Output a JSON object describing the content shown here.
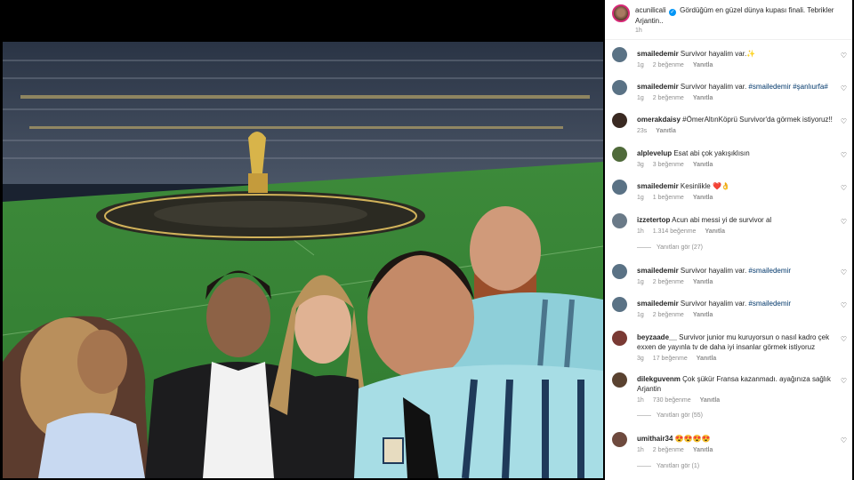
{
  "caption": {
    "username": "acunilicali",
    "text": "Gördüğüm en güzel dünya kupası finali. Tebrikler Arjantin..",
    "time": "1h"
  },
  "comments": [
    {
      "username": "smailedemir",
      "text": "Survivor hayalim var.✨",
      "time": "1g",
      "likes": "2 beğenme",
      "reply": "Yanıtla",
      "avatar_color": "#5a7285"
    },
    {
      "username": "smailedemir",
      "text": "Survivor hayalim var. ",
      "tags": "#smailedemir #şanlıurfa#",
      "time": "1g",
      "likes": "2 beğenme",
      "reply": "Yanıtla",
      "avatar_color": "#5a7285"
    },
    {
      "username": "omerakdaisy",
      "text": "#ÖmerAltınKöprü Survivor'da görmek istiyoruz!!",
      "time": "23s",
      "likes": "",
      "reply": "Yanıtla",
      "avatar_color": "#3a2a22"
    },
    {
      "username": "alplevelup",
      "text": "Esat abi çok yakışıklısın",
      "time": "3g",
      "likes": "3 beğenme",
      "reply": "Yanıtla",
      "avatar_color": "#4f6a3a"
    },
    {
      "username": "smailedemir",
      "text": "Kesinlikle ❤️👌",
      "time": "1g",
      "likes": "1 beğenme",
      "reply": "Yanıtla",
      "avatar_color": "#5a7285"
    },
    {
      "username": "izzetertop",
      "text": "Acun abi messi yi de survivor al",
      "time": "1h",
      "likes": "1.314 beğenme",
      "reply": "Yanıtla",
      "view_replies": "Yanıtları gör (27)",
      "avatar_color": "#6a7a88"
    },
    {
      "username": "smailedemir",
      "text": "Survivor hayalim var. ",
      "tags": "#smailedemir",
      "time": "1g",
      "likes": "2 beğenme",
      "reply": "Yanıtla",
      "avatar_color": "#5a7285"
    },
    {
      "username": "smailedemir",
      "text": "Survivor hayalim var. ",
      "tags": "#smailedemir",
      "time": "1g",
      "likes": "2 beğenme",
      "reply": "Yanıtla",
      "avatar_color": "#5a7285"
    },
    {
      "username": "beyzaade__",
      "text": "Survivor junior mu kuruyorsun o nasıl kadro çek exxen de yayınla tv de daha iyi insanlar görmek istiyoruz",
      "time": "3g",
      "likes": "17 beğenme",
      "reply": "Yanıtla",
      "avatar_color": "#7a3a34"
    },
    {
      "username": "dilekguvenm",
      "text": "Çok şükür Fransa kazanmadı. ayağınıza sağlık Arjantin",
      "time": "1h",
      "likes": "730 beğenme",
      "reply": "Yanıtla",
      "view_replies": "Yanıtları gör (55)",
      "avatar_color": "#5a4230"
    },
    {
      "username": "umithair34",
      "text": "😍😍😍😍",
      "time": "1h",
      "likes": "2 beğenme",
      "reply": "Yanıtla",
      "view_replies": "Yanıtları gör (1)",
      "avatar_color": "#6e4a3e"
    }
  ],
  "icons": {
    "heart": "heart-outline-icon",
    "verified": "verified-badge-icon"
  },
  "colors": {
    "hashtag": "#00376b",
    "meta": "#8e8e8e",
    "text": "#262626",
    "verified": "#0095f6"
  }
}
